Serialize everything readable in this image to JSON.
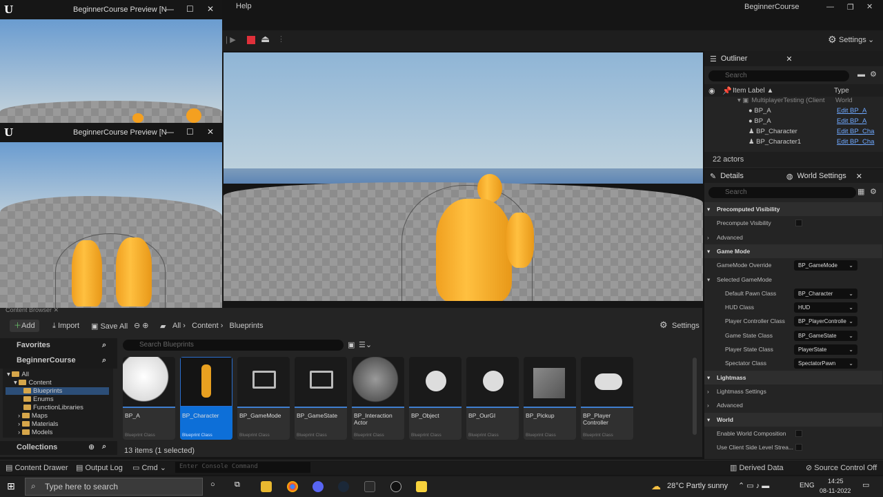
{
  "menu": {
    "help": "Help",
    "project": "BeginnerCourse",
    "settings": "Settings"
  },
  "windows": [
    {
      "title": "BeginnerCourse Preview [N"
    },
    {
      "title": "BeginnerCourse Preview [N"
    }
  ],
  "outliner": {
    "title": "Outliner",
    "search": "Search",
    "col_label": "Item Label ▲",
    "col_type": "Type",
    "rows": [
      {
        "label": "MultiplayerTesting (Client",
        "type": "World"
      },
      {
        "label": "BP_A",
        "type": "Edit BP_A"
      },
      {
        "label": "BP_A",
        "type": "Edit BP_A"
      },
      {
        "label": "BP_Character",
        "type": "Edit BP_Cha"
      },
      {
        "label": "BP_Character1",
        "type": "Edit BP_Cha"
      }
    ],
    "count": "22 actors"
  },
  "details": {
    "tab1": "Details",
    "tab2": "World Settings",
    "search": "Search",
    "rows": [
      {
        "text": "Precomputed Visibility",
        "kind": "sec"
      },
      {
        "text": "Precompute Visibility",
        "kind": "check"
      },
      {
        "text": "Advanced",
        "kind": "sub"
      },
      {
        "text": "Game Mode",
        "kind": "sec"
      },
      {
        "text": "GameMode Override",
        "kind": "dd",
        "value": "BP_GameMode"
      },
      {
        "text": "Selected GameMode",
        "kind": "sub"
      },
      {
        "text": "Default Pawn Class",
        "kind": "dd2",
        "value": "BP_Character"
      },
      {
        "text": "HUD Class",
        "kind": "dd2",
        "value": "HUD"
      },
      {
        "text": "Player Controller Class",
        "kind": "dd2",
        "value": "BP_PlayerControlle"
      },
      {
        "text": "Game State Class",
        "kind": "dd2",
        "value": "BP_GameState"
      },
      {
        "text": "Player State Class",
        "kind": "dd2",
        "value": "PlayerState"
      },
      {
        "text": "Spectator Class",
        "kind": "dd2",
        "value": "SpectatorPawn"
      },
      {
        "text": "Lightmass",
        "kind": "sec"
      },
      {
        "text": "Lightmass Settings",
        "kind": "sub"
      },
      {
        "text": "Advanced",
        "kind": "sub"
      },
      {
        "text": "World",
        "kind": "sec"
      },
      {
        "text": "Enable World Composition",
        "kind": "check"
      },
      {
        "text": "Use Client Side Level Strea...",
        "kind": "check"
      }
    ]
  },
  "content": {
    "tab": "Content Browser",
    "add": "Add",
    "import": "Import",
    "saveall": "Save All",
    "crumbs": [
      "All",
      "Content",
      "Blueprints"
    ],
    "settings": "Settings",
    "favorites": "Favorites",
    "project": "BeginnerCourse",
    "search": "Search Blueprints",
    "collections": "Collections",
    "status": "13 items (1 selected)",
    "tree": [
      "All",
      "Content",
      "Blueprints",
      "Enums",
      "FunctionLibraries",
      "Maps",
      "Materials",
      "Models"
    ],
    "assets": [
      {
        "name": "BP_A",
        "cls": "Blueprint Class"
      },
      {
        "name": "BP_Character",
        "cls": "Blueprint Class"
      },
      {
        "name": "BP_GameMode",
        "cls": "Blueprint Class"
      },
      {
        "name": "BP_GameState",
        "cls": "Blueprint Class"
      },
      {
        "name": "BP_Interaction Actor",
        "cls": "Blueprint Class"
      },
      {
        "name": "BP_Object",
        "cls": "Blueprint Class"
      },
      {
        "name": "BP_OurGI",
        "cls": "Blueprint Class"
      },
      {
        "name": "BP_Pickup",
        "cls": "Blueprint Class"
      },
      {
        "name": "BP_Player Controller",
        "cls": "Blueprint Class"
      }
    ]
  },
  "statusbar": {
    "drawer": "Content Drawer",
    "output": "Output Log",
    "cmd": "Cmd",
    "console": "Enter Console Command",
    "derived": "Derived Data",
    "source": "Source Control Off"
  },
  "taskbar": {
    "search": "Type here to search",
    "weather": "28°C  Partly sunny",
    "lang": "ENG",
    "time": "14:25",
    "date": "08-11-2022"
  }
}
